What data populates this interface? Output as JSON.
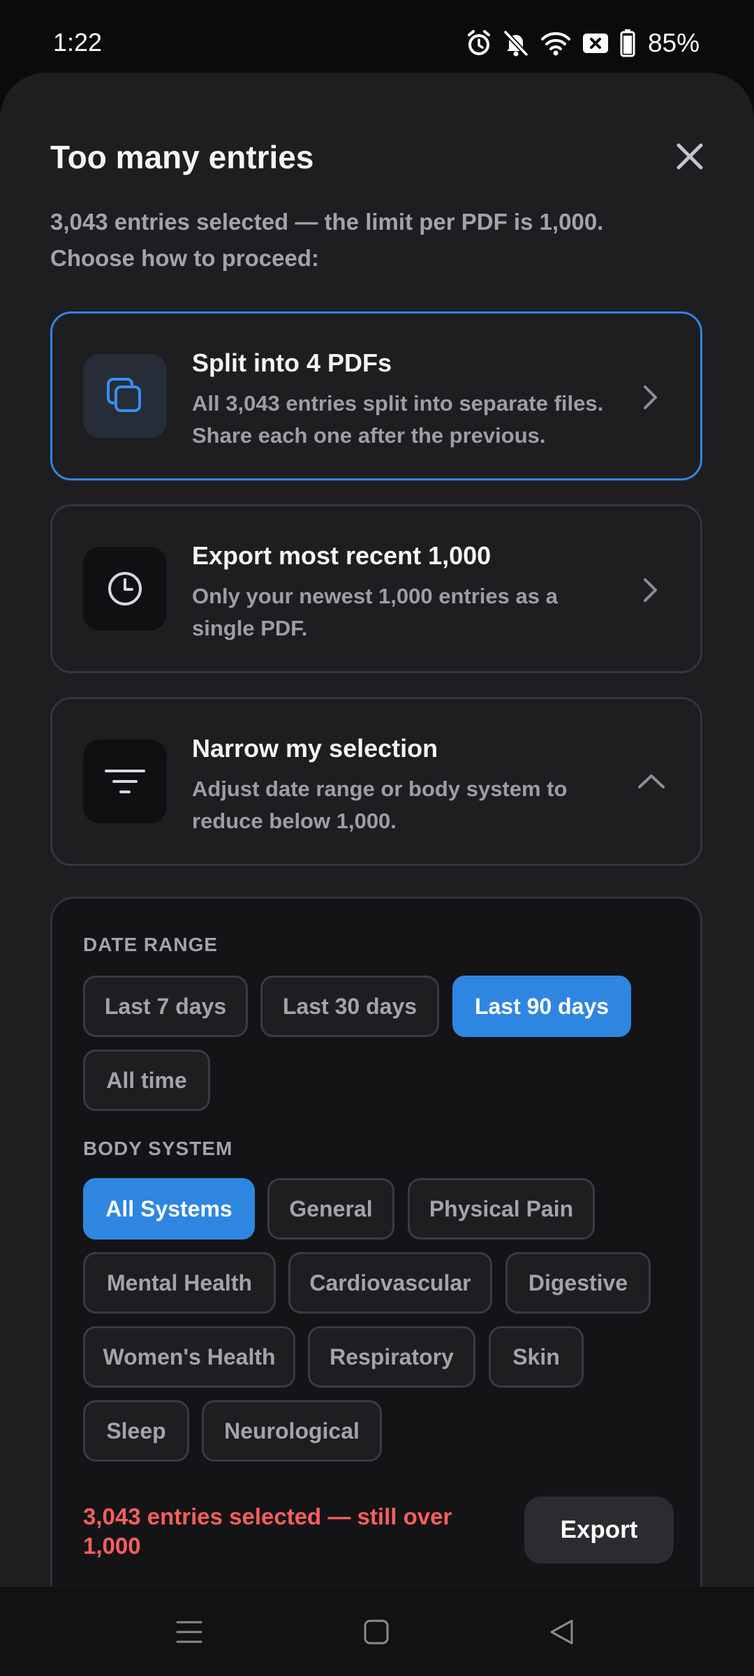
{
  "status_bar": {
    "time": "1:22",
    "battery_percent": "85%",
    "icons": [
      "alarm-icon",
      "bell-muted-icon",
      "wifi-icon",
      "data-off-icon",
      "battery-icon"
    ]
  },
  "dialog": {
    "title": "Too many entries",
    "subtitle": "3,043 entries selected — the limit per PDF is 1,000. Choose how to proceed:",
    "options": [
      {
        "title": "Split into 4 PDFs",
        "description": "All 3,043 entries split into separate files. Share each one after the previous.",
        "icon": "copy-stack-icon",
        "selected": true
      },
      {
        "title": "Export most recent 1,000",
        "description": "Only your newest 1,000 entries as a single PDF.",
        "icon": "clock-icon",
        "selected": false
      },
      {
        "title": "Narrow my selection",
        "description": "Adjust date range or body system to reduce below 1,000.",
        "icon": "filter-lines-icon",
        "selected": false,
        "expanded": true
      }
    ],
    "narrow": {
      "date_range_label": "DATE RANGE",
      "date_ranges": [
        "Last 7 days",
        "Last 30 days",
        "Last 90 days",
        "All time"
      ],
      "date_range_selected": "Last 90 days",
      "body_system_label": "BODY SYSTEM",
      "body_systems": [
        "All Systems",
        "General",
        "Physical Pain",
        "Mental Health",
        "Cardiovascular",
        "Digestive",
        "Women's Health",
        "Respiratory",
        "Skin",
        "Sleep",
        "Neurological"
      ],
      "body_system_selected": "All Systems",
      "warning": "3,043 entries selected — still over 1,000",
      "export_label": "Export"
    }
  },
  "nav_bar": {
    "icons": [
      "menu-lines-icon",
      "home-square-icon",
      "back-triangle-icon"
    ]
  },
  "colors": {
    "accent": "#2f86e0",
    "warning": "#ff5e5e",
    "sheet_bg": "#1e1e21",
    "panel_bg": "#141416"
  }
}
